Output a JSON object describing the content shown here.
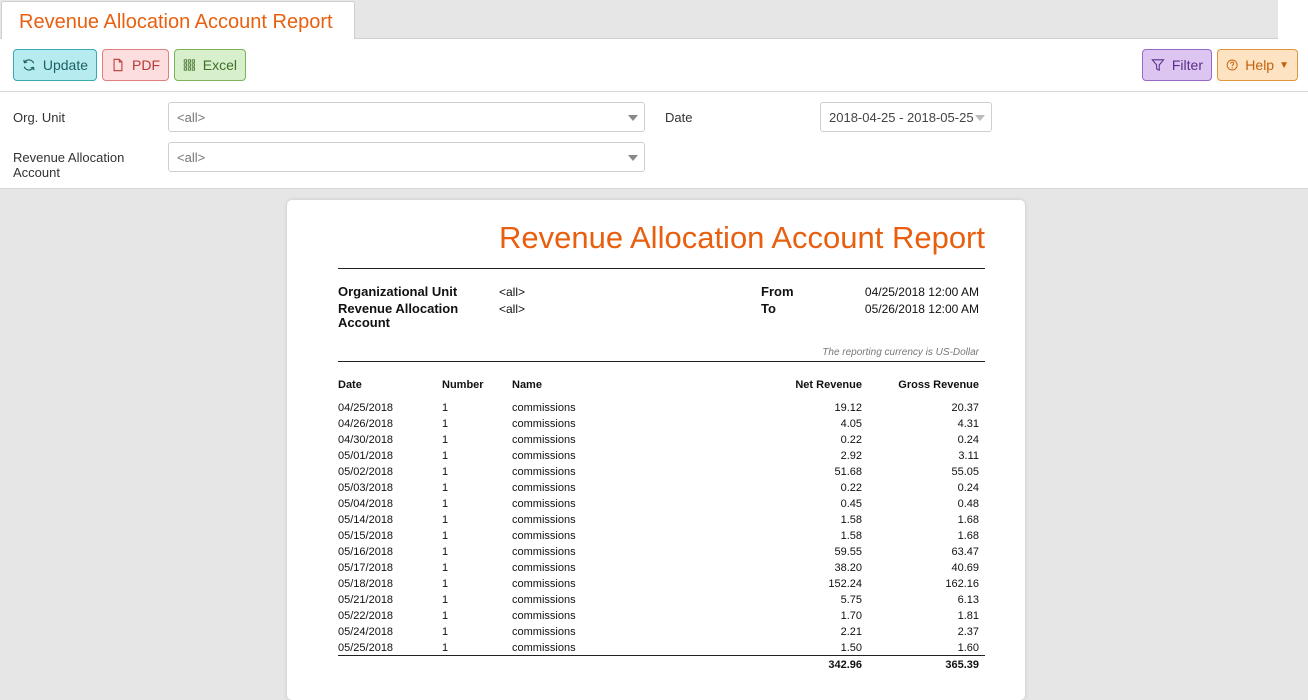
{
  "tab": {
    "title": "Revenue Allocation Account Report"
  },
  "toolbar": {
    "update_label": "Update",
    "pdf_label": "PDF",
    "excel_label": "Excel",
    "filter_label": "Filter",
    "help_label": "Help"
  },
  "filters": {
    "org_unit_label": "Org. Unit",
    "org_unit_value": "<all>",
    "date_label": "Date",
    "date_value": "2018-04-25 - 2018-05-25",
    "account_label_1": "Revenue Allocation",
    "account_label_2": "Account",
    "account_value": "<all>"
  },
  "report": {
    "title": "Revenue Allocation Account Report",
    "org_unit_label": "Organizational Unit",
    "org_unit_value": "<all>",
    "account_label_1": "Revenue Allocation",
    "account_label_2": "Account",
    "account_value": "<all>",
    "from_label": "From",
    "from_value": "04/25/2018 12:00 AM",
    "to_label": "To",
    "to_value": "05/26/2018 12:00 AM",
    "currency_note": "The reporting currency is US-Dollar",
    "columns": [
      "Date",
      "Number",
      "Name",
      "Net Revenue",
      "Gross Revenue"
    ],
    "rows": [
      [
        "04/25/2018",
        "1",
        "commissions",
        "19.12",
        "20.37"
      ],
      [
        "04/26/2018",
        "1",
        "commissions",
        "4.05",
        "4.31"
      ],
      [
        "04/30/2018",
        "1",
        "commissions",
        "0.22",
        "0.24"
      ],
      [
        "05/01/2018",
        "1",
        "commissions",
        "2.92",
        "3.11"
      ],
      [
        "05/02/2018",
        "1",
        "commissions",
        "51.68",
        "55.05"
      ],
      [
        "05/03/2018",
        "1",
        "commissions",
        "0.22",
        "0.24"
      ],
      [
        "05/04/2018",
        "1",
        "commissions",
        "0.45",
        "0.48"
      ],
      [
        "05/14/2018",
        "1",
        "commissions",
        "1.58",
        "1.68"
      ],
      [
        "05/15/2018",
        "1",
        "commissions",
        "1.58",
        "1.68"
      ],
      [
        "05/16/2018",
        "1",
        "commissions",
        "59.55",
        "63.47"
      ],
      [
        "05/17/2018",
        "1",
        "commissions",
        "38.20",
        "40.69"
      ],
      [
        "05/18/2018",
        "1",
        "commissions",
        "152.24",
        "162.16"
      ],
      [
        "05/21/2018",
        "1",
        "commissions",
        "5.75",
        "6.13"
      ],
      [
        "05/22/2018",
        "1",
        "commissions",
        "1.70",
        "1.81"
      ],
      [
        "05/24/2018",
        "1",
        "commissions",
        "2.21",
        "2.37"
      ],
      [
        "05/25/2018",
        "1",
        "commissions",
        "1.50",
        "1.60"
      ]
    ],
    "total_net": "342.96",
    "total_gross": "365.39"
  },
  "icons": {
    "update": "refresh-icon",
    "pdf": "file-icon",
    "excel": "grid-icon",
    "filter": "funnel-icon",
    "help": "question-circle-icon"
  },
  "colors": {
    "accent": "#e8600f"
  }
}
